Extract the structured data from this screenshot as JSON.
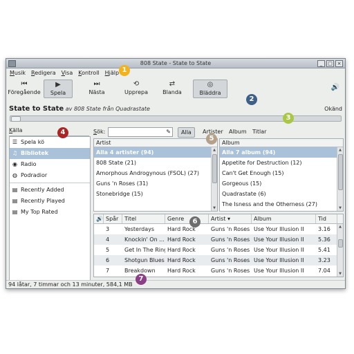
{
  "window": {
    "title": "808 State - State to State"
  },
  "menu": [
    "Musik",
    "Redigera",
    "Visa",
    "Kontroll",
    "Hjälp"
  ],
  "toolbar": {
    "previous": "Föregående",
    "play": "Spela",
    "next": "Nästa",
    "repeat": "Upprepa",
    "shuffle": "Blanda",
    "browse": "Bläddra"
  },
  "now_playing": {
    "title": "State to State",
    "prefix_by": "av",
    "artist": "808 State",
    "prefix_from": "från",
    "album": "Quadrastate",
    "time": "Okänd"
  },
  "sources": {
    "header": "Källa",
    "items": [
      "Spela kö",
      "Bibliotek",
      "Radio",
      "Podradior"
    ],
    "playlists": [
      "Recently Added",
      "Recently Played",
      "My Top Rated"
    ]
  },
  "search": {
    "label": "Sök:",
    "filters": [
      "Alla",
      "Artister",
      "Album",
      "Titlar"
    ]
  },
  "artist_pane": {
    "header": "Artist",
    "rows": [
      "Alla 4 artister (94)",
      "808 State (21)",
      "Amorphous Androgynous (FSOL) (27)",
      "Guns 'n Roses (31)",
      "Stonebridge (15)"
    ]
  },
  "album_pane": {
    "header": "Album",
    "rows": [
      "Alla 7 album (94)",
      "Appetite for Destruction (12)",
      "Can't Get Enough (15)",
      "Gorgeous (15)",
      "Quadrastate (6)",
      "The Isness and the Otherness (27)"
    ]
  },
  "tracks": {
    "columns": [
      "",
      "Spår",
      "Titel",
      "Genre",
      "Artist",
      "Album",
      "Tid"
    ],
    "rows": [
      [
        "",
        "3",
        "Yesterdays",
        "Hard Rock",
        "Guns 'n Roses",
        "Use Your Illusion II",
        "3.16"
      ],
      [
        "",
        "4",
        "Knockin' On ...",
        "Hard Rock",
        "Guns 'n Roses",
        "Use Your Illusion II",
        "5.36"
      ],
      [
        "",
        "5",
        "Get In The Ring",
        "Hard Rock",
        "Guns 'n Roses",
        "Use Your Illusion II",
        "5.41"
      ],
      [
        "",
        "6",
        "Shotgun Blues",
        "Hard Rock",
        "Guns 'n Roses",
        "Use Your Illusion II",
        "3.23"
      ],
      [
        "",
        "7",
        "Breakdown",
        "Hard Rock",
        "Guns 'n Roses",
        "Use Your Illusion II",
        "7.04"
      ]
    ]
  },
  "status": "94 låtar, 7 timmar och 13 minuter, 584,1 MB",
  "callouts": [
    "1",
    "2",
    "3",
    "4",
    "5",
    "6",
    "7"
  ],
  "colors": {
    "c1": "#f2b21b",
    "c2": "#3e5f86",
    "c3": "#a9c744",
    "c4": "#ad2626",
    "c5": "#b5a189",
    "c6": "#6e6e6e",
    "c7": "#8a3f86"
  }
}
